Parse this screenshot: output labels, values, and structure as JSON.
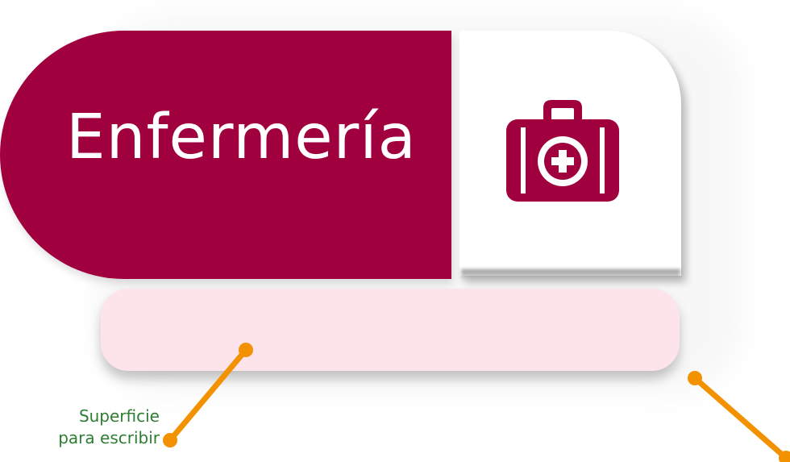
{
  "sign": {
    "title": "Enfermería",
    "icon": "first-aid-kit-icon",
    "colors": {
      "main": "#a1003e",
      "panel": "#ffffff",
      "write_bar": "#fce4ea"
    }
  },
  "callout": {
    "line1": "Superficie",
    "line2": "para escribir",
    "color": "#2e7d32",
    "pointer_color": "#f39200"
  }
}
